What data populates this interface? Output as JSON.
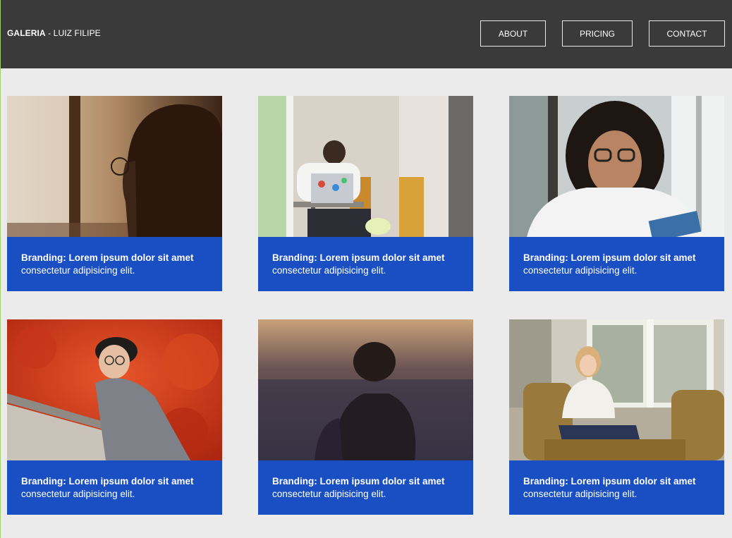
{
  "header": {
    "brand_bold": "GALERIA",
    "brand_rest": " - LUIZ FILIPE",
    "nav": [
      {
        "label": "ABOUT"
      },
      {
        "label": "PRICING"
      },
      {
        "label": "CONTACT"
      }
    ]
  },
  "gallery": {
    "cards": [
      {
        "title": "Branding: Lorem ipsum dolor sit amet",
        "text": "consectetur adipisicing elit."
      },
      {
        "title": "Branding: Lorem ipsum dolor sit amet",
        "text": "consectetur adipisicing elit."
      },
      {
        "title": "Branding: Lorem ipsum dolor sit amet",
        "text": "consectetur adipisicing elit."
      },
      {
        "title": "Branding: Lorem ipsum dolor sit amet",
        "text": "consectetur adipisicing elit."
      },
      {
        "title": "Branding: Lorem ipsum dolor sit amet",
        "text": "consectetur adipisicing elit."
      },
      {
        "title": "Branding: Lorem ipsum dolor sit amet",
        "text": "consectetur adipisicing elit."
      }
    ]
  },
  "colors": {
    "header_bg": "#3a3a3a",
    "page_bg": "#ebebeb",
    "caption_bg": "#1a4fc4"
  }
}
